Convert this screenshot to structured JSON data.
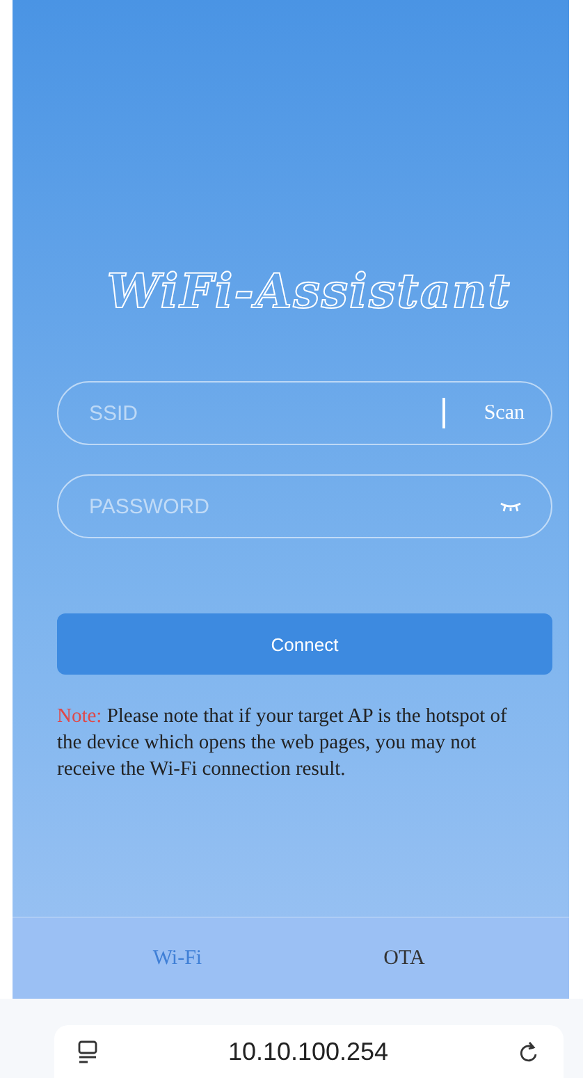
{
  "title": "WiFi-Assistant",
  "ssid_field": {
    "placeholder": "SSID",
    "scan_label": "Scan"
  },
  "password_field": {
    "placeholder": "PASSWORD",
    "visible": false
  },
  "connect_button": "Connect",
  "note": {
    "label": "Note:",
    "text": "Please note that if your target AP is the hotspot of the device which opens the web pages, you may not receive the Wi-Fi connection result."
  },
  "tabs": [
    {
      "label": "Wi-Fi",
      "selected": true
    },
    {
      "label": "OTA",
      "selected": false
    }
  ],
  "address_bar": {
    "url": "10.10.100.254"
  }
}
